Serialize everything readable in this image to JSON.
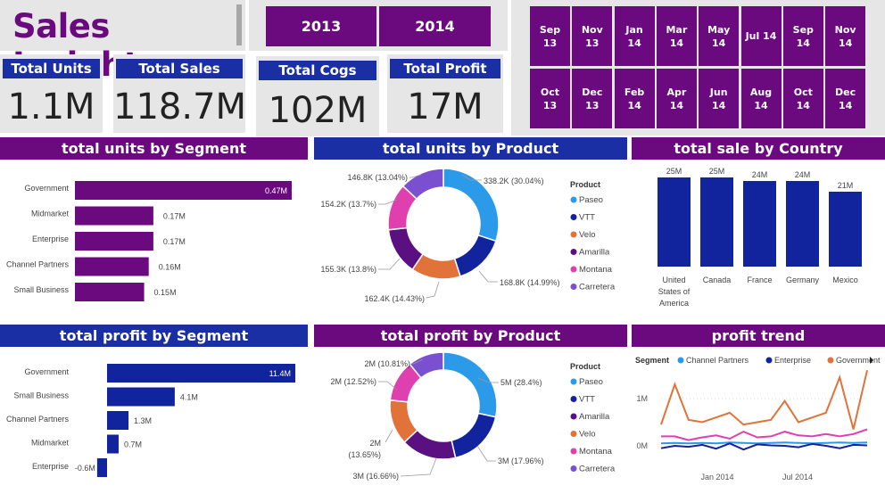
{
  "title": "Sales Insights",
  "years": [
    "2013",
    "2014"
  ],
  "months": [
    [
      "Sep",
      "13"
    ],
    [
      "Nov",
      "13"
    ],
    [
      "Jan",
      "14"
    ],
    [
      "Mar",
      "14"
    ],
    [
      "May",
      "14"
    ],
    [
      "Jul 14",
      ""
    ],
    [
      "Sep",
      "14"
    ],
    [
      "Nov",
      "14"
    ],
    [
      "Oct",
      "13"
    ],
    [
      "Dec",
      "13"
    ],
    [
      "Feb",
      "14"
    ],
    [
      "Apr",
      "14"
    ],
    [
      "Jun",
      "14"
    ],
    [
      "Aug",
      "14"
    ],
    [
      "Oct",
      "14"
    ],
    [
      "Dec",
      "14"
    ]
  ],
  "kpis": {
    "units": {
      "label": "Total Units",
      "value": "1.1M"
    },
    "sales": {
      "label": "Total Sales",
      "value": "118.7M"
    },
    "cogs": {
      "label": "Total Cogs",
      "value": "102M"
    },
    "profit": {
      "label": "Total Profit",
      "value": "17M"
    }
  },
  "headers": {
    "units_segment": "total units by Segment",
    "units_product": "total units by Product",
    "sale_country": "total sale by Country",
    "profit_segment": "total profit by Segment",
    "profit_product": "total profit by Product",
    "profit_trend": "profit trend"
  },
  "colors": {
    "purple": "#6b0a7e",
    "blue": "#1a2fa3",
    "orange": "#e0723a",
    "pink": "#e03fb0",
    "lightblue": "#2b9ae8",
    "violet": "#7a4fd0",
    "navy": "#12239e",
    "darkpurple": "#5a1080"
  },
  "chart_data": [
    {
      "id": "units_segment",
      "type": "bar",
      "orientation": "horizontal",
      "categories": [
        "Government",
        "Midmarket",
        "Enterprise",
        "Channel Partners",
        "Small Business"
      ],
      "values": [
        0.47,
        0.17,
        0.17,
        0.16,
        0.15
      ],
      "labels": [
        "0.47M",
        "0.17M",
        "0.17M",
        "0.16M",
        "0.15M"
      ],
      "unit": "M"
    },
    {
      "id": "units_product",
      "type": "pie",
      "legend_title": "Product",
      "legend": [
        "Paseo",
        "VTT",
        "Velo",
        "Amarilla",
        "Montana",
        "Carretera"
      ],
      "slices": [
        {
          "name": "Paseo",
          "value": 338.2,
          "label": "338.2K (30.04%)",
          "color": "#2b9ae8"
        },
        {
          "name": "VTT",
          "value": 168.8,
          "label": "168.8K (14.99%)",
          "color": "#12239e"
        },
        {
          "name": "Velo",
          "value": 162.4,
          "label": "162.4K (14.43%)",
          "color": "#e0723a"
        },
        {
          "name": "Amarilla",
          "value": 155.3,
          "label": "155.3K (13.8%)",
          "color": "#5a1080"
        },
        {
          "name": "Montana",
          "value": 154.2,
          "label": "154.2K (13.7%)",
          "color": "#e03fb0"
        },
        {
          "name": "Carretera",
          "value": 146.8,
          "label": "146.8K (13.04%)",
          "color": "#7a4fd0"
        }
      ]
    },
    {
      "id": "sale_country",
      "type": "bar",
      "orientation": "vertical",
      "categories": [
        "United States of America",
        "Canada",
        "France",
        "Germany",
        "Mexico"
      ],
      "category_lines": [
        [
          "United",
          "States of",
          "America"
        ],
        [
          "Canada"
        ],
        [
          "France"
        ],
        [
          "Germany"
        ],
        [
          "Mexico"
        ]
      ],
      "values": [
        25,
        25,
        24,
        24,
        21
      ],
      "labels": [
        "25M",
        "25M",
        "24M",
        "24M",
        "21M"
      ],
      "unit": "M"
    },
    {
      "id": "profit_segment",
      "type": "bar",
      "orientation": "horizontal",
      "categories": [
        "Government",
        "Small Business",
        "Channel Partners",
        "Midmarket",
        "Enterprise"
      ],
      "values": [
        11.4,
        4.1,
        1.3,
        0.7,
        -0.6
      ],
      "labels": [
        "11.4M",
        "4.1M",
        "1.3M",
        "0.7M",
        "-0.6M"
      ],
      "unit": "M"
    },
    {
      "id": "profit_product",
      "type": "pie",
      "legend_title": "Product",
      "legend": [
        "Paseo",
        "VTT",
        "Amarilla",
        "Velo",
        "Montana",
        "Carretera"
      ],
      "slices": [
        {
          "name": "Paseo",
          "value": 28.4,
          "label": "5M (28.4%)",
          "color": "#2b9ae8"
        },
        {
          "name": "VTT",
          "value": 17.96,
          "label": "3M (17.96%)",
          "color": "#12239e"
        },
        {
          "name": "Amarilla",
          "value": 16.66,
          "label": "3M (16.66%)",
          "color": "#5a1080"
        },
        {
          "name": "Velo",
          "value": 13.65,
          "label": "2M (13.65%)",
          "color": "#e0723a"
        },
        {
          "name": "Montana",
          "value": 12.52,
          "label": "2M (12.52%)",
          "color": "#e03fb0"
        },
        {
          "name": "Carretera",
          "value": 10.81,
          "label": "2M (10.81%)",
          "color": "#7a4fd0"
        }
      ]
    },
    {
      "id": "profit_trend",
      "type": "line",
      "legend_title": "Segment",
      "x_ticks": [
        "Jan 2014",
        "Jul 2014"
      ],
      "y_ticks": [
        "1M",
        "0M"
      ],
      "series": [
        {
          "name": "Channel Partners",
          "color": "#2b9ae8",
          "values": [
            0.05,
            0.06,
            0.05,
            0.06,
            0.05,
            0.07,
            0.06,
            0.05,
            0.06,
            0.07,
            0.06,
            0.05,
            0.06,
            0.07,
            0.06,
            0.07
          ]
        },
        {
          "name": "Enterprise",
          "color": "#12239e",
          "values": [
            -0.05,
            0.0,
            -0.02,
            0.02,
            -0.06,
            0.05,
            -0.08,
            0.03,
            0.01,
            0.0,
            -0.03,
            0.04,
            0.0,
            -0.05,
            0.02,
            0.01
          ]
        },
        {
          "name": "Government",
          "color": "#e0723a",
          "values": [
            0.45,
            1.3,
            0.55,
            0.5,
            0.6,
            0.7,
            0.45,
            0.5,
            0.55,
            0.95,
            0.5,
            0.6,
            0.7,
            1.45,
            0.35,
            1.6
          ]
        },
        {
          "name": "Montana",
          "color": "#e03fb0",
          "values": [
            0.2,
            0.2,
            0.12,
            0.18,
            0.22,
            0.15,
            0.3,
            0.18,
            0.2,
            0.3,
            0.22,
            0.2,
            0.25,
            0.2,
            0.25,
            0.35
          ]
        }
      ],
      "legend_series": [
        "Channel Partners",
        "Enterprise",
        "Government"
      ]
    }
  ]
}
